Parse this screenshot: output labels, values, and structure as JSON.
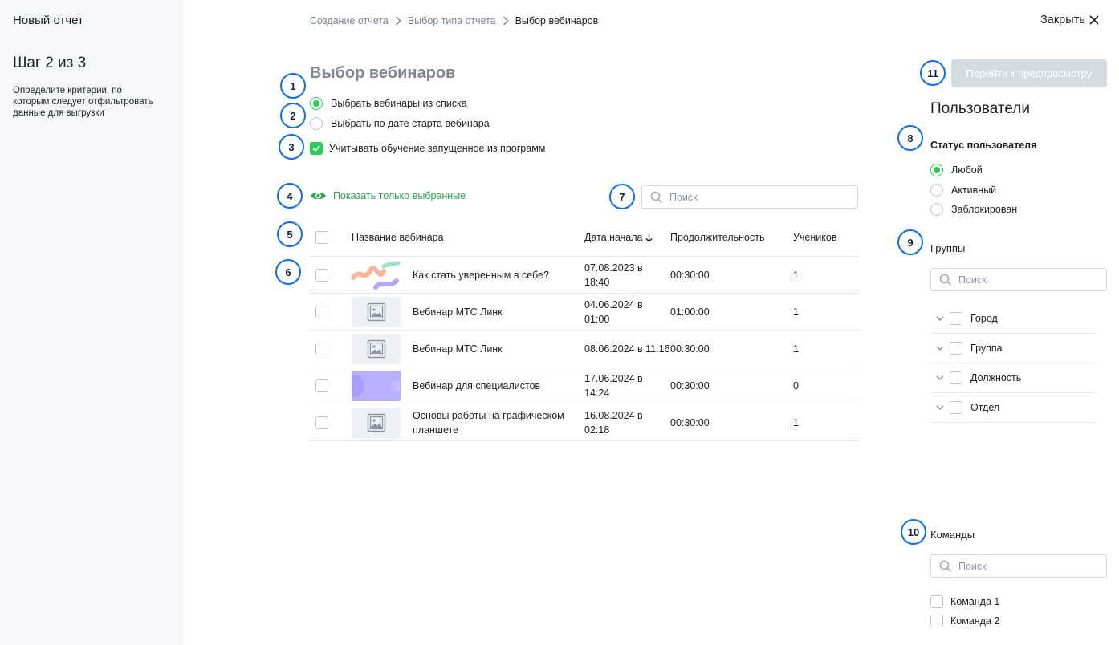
{
  "sidebar": {
    "title": "Новый отчет",
    "step": "Шаг 2 из 3",
    "description": "Определите критерии, по которым следует отфильтровать данные для выгрузки"
  },
  "breadcrumb": [
    "Создание отчета",
    "Выбор типа отчета",
    "Выбор вебинаров"
  ],
  "close_label": "Закрыть",
  "markers": [
    "1",
    "2",
    "3",
    "4",
    "5",
    "6",
    "7",
    "8",
    "9",
    "10",
    "11"
  ],
  "main": {
    "title": "Выбор вебинаров",
    "radio_list": "Выбрать вебинары из списка",
    "radio_date": "Выбрать по дате старта вебинара",
    "include_programs": "Учитывать обучение запущенное из программ",
    "show_selected": "Показать только выбранные",
    "search_placeholder": "Поиск"
  },
  "table": {
    "headers": {
      "name": "Название вебинара",
      "date": "Дата начала",
      "duration": "Продолжительность",
      "students": "Учеников"
    },
    "rows": [
      {
        "name": "Как стать уверенным в себе?",
        "date": "07.08.2023 в 18:40",
        "duration": "00:30:00",
        "students": "1",
        "thumb": "art"
      },
      {
        "name": "Вебинар МТС Линк",
        "date": "04.06.2024 в 01:00",
        "duration": "01:00:00",
        "students": "1",
        "thumb": "placeholder"
      },
      {
        "name": "Вебинар МТС Линк",
        "date": "08.06.2024 в 11:16",
        "duration": "00:30:00",
        "students": "1",
        "thumb": "placeholder"
      },
      {
        "name": "Вебинар для специалистов",
        "date": "17.06.2024 в 14:24",
        "duration": "00:30:00",
        "students": "0",
        "thumb": "purple"
      },
      {
        "name": "Основы работы на графическом планшете",
        "date": "16.08.2024 в 02:18",
        "duration": "00:30:00",
        "students": "1",
        "thumb": "placeholder"
      }
    ]
  },
  "right": {
    "preview_button": "Перейти к предпросмотру",
    "users_title": "Пользователи",
    "status_label": "Статус пользователя",
    "status_options": [
      "Любой",
      "Активный",
      "Заблокирован"
    ],
    "groups_label": "Группы",
    "groups_search_placeholder": "Поиск",
    "groups": [
      "Город",
      "Группа",
      "Должность",
      "Отдел"
    ],
    "teams_label": "Команды",
    "teams_search_placeholder": "Поиск",
    "teams": [
      "Команда 1",
      "Команда 2"
    ]
  },
  "colors": {
    "accent_green": "#26cd58",
    "marker_blue": "#0a6df5",
    "disabled_button": "#d5dbe2"
  }
}
